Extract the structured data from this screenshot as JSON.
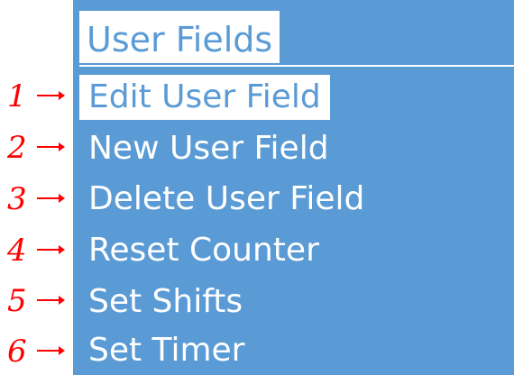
{
  "menu": {
    "title": "User Fields",
    "items": [
      {
        "label": "Edit User Field",
        "selected": true
      },
      {
        "label": "New User Field",
        "selected": false
      },
      {
        "label": "Delete User Field",
        "selected": false
      },
      {
        "label": "Reset Counter",
        "selected": false
      },
      {
        "label": "Set Shifts",
        "selected": false
      },
      {
        "label": "Set Timer",
        "selected": false
      }
    ]
  },
  "annotations": {
    "numbers": [
      "1",
      "2",
      "3",
      "4",
      "5",
      "6"
    ],
    "arrow_icon": "right-arrow-icon",
    "color": "#ff0000"
  },
  "theme": {
    "panel_color": "#5b9bd5",
    "highlight_color": "#ffffff"
  }
}
